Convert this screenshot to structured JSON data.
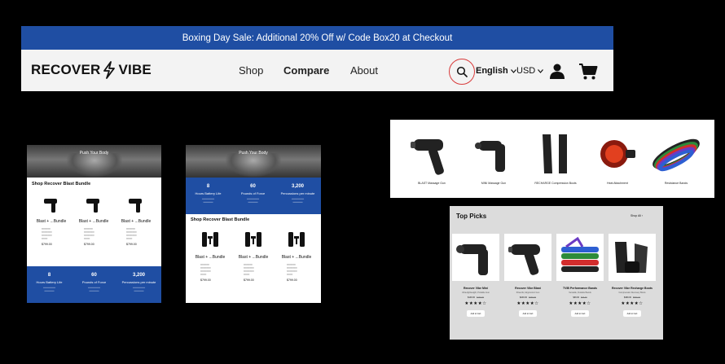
{
  "header": {
    "promo": "Boxing Day Sale: Additional 20% Off w/ Code Box20 at Checkout",
    "logo_left": "RECOVER",
    "logo_right": "VIBE",
    "nav": [
      "Shop",
      "Compare",
      "About"
    ],
    "language": "English",
    "currency": "USD"
  },
  "mobile1": {
    "hero": "Push Your Body",
    "section_title": "Shop Recover Blast Bundle",
    "products": [
      {
        "name": "Blast + ...Bundle",
        "price": "$799.00"
      },
      {
        "name": "Blast + ...Bundle",
        "price": "$799.00"
      },
      {
        "name": "Blast + ...Bundle",
        "price": "$799.00"
      }
    ],
    "stats": [
      {
        "num": "8",
        "label": "Hours Battery Life"
      },
      {
        "num": "60",
        "label": "Pounds of Force"
      },
      {
        "num": "3,200",
        "label": "Percussions per minute"
      }
    ]
  },
  "mobile2": {
    "hero": "Push Your Body",
    "stats": [
      {
        "num": "8",
        "label": "Hours Battery Life"
      },
      {
        "num": "60",
        "label": "Pounds of Force"
      },
      {
        "num": "3,200",
        "label": "Percussions per minute"
      }
    ],
    "section_title": "Shop Recover Blast Bundle",
    "products": [
      {
        "name": "Blast + ...Bundle",
        "price": "$799.00"
      },
      {
        "name": "Blast + ...Bundle",
        "price": "$799.00"
      },
      {
        "name": "Blast + ...Bundle",
        "price": "$799.00"
      }
    ]
  },
  "strip": {
    "items": [
      "BLAST Massage Gun",
      "MINI Massage Gun",
      "RECHARGE Compression Boots",
      "Heat Attachment",
      "Resistance Bands"
    ]
  },
  "picks": {
    "title": "Top Picks",
    "shop_all": "Shop All",
    "items": [
      {
        "name": "Recover Vibe Mini",
        "sub": "Ultra-lightweight, Portable Gun",
        "price": "$149.00",
        "old": "$199.00",
        "stars": "★★★★☆",
        "button": "Add to Cart"
      },
      {
        "name": "Recover Vibe Blast",
        "sub": "Powerful, Ergonomic Gun",
        "price": "$249.00",
        "old": "$299.00",
        "stars": "★★★★☆",
        "button": "Add to Cart"
      },
      {
        "name": "TVIB Performance Bands",
        "sub": "Versatile, Durable Bands",
        "price": "$39.00",
        "old": "$49.00",
        "stars": "★★★★☆",
        "button": "Add to Cart"
      },
      {
        "name": "Recover Vibe Recharge Boots",
        "sub": "Compression Recovery Boots",
        "price": "$499.00",
        "old": "$599.00",
        "stars": "★★★★☆",
        "button": "Add to Cart"
      }
    ]
  },
  "colors": {
    "brand_blue": "#1f4ea3",
    "highlight_red": "#d83a3a"
  }
}
